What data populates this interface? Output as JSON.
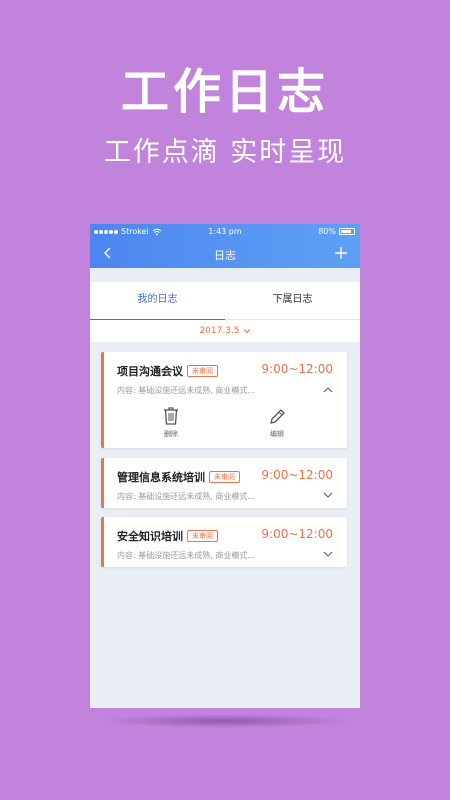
{
  "hero": {
    "title": "工作日志",
    "subtitle": "工作点滴 实时呈现"
  },
  "status_bar": {
    "carrier": "Strokei",
    "time": "1:43 pm",
    "battery": "80%"
  },
  "nav": {
    "title": "日志",
    "back_icon": "chevron-left-icon",
    "add_icon": "plus-icon"
  },
  "tabs": [
    {
      "label": "我的日志",
      "active": true
    },
    {
      "label": "下属日志",
      "active": false
    }
  ],
  "date_filter": {
    "value": "2017.3.5"
  },
  "logs": [
    {
      "title": "项目沟通会议",
      "badge": "未审阅",
      "time": "9:00~12:00",
      "content": "内容: 基础设施还远未成熟, 商业模式...",
      "expanded": true,
      "actions": [
        {
          "label": "删除",
          "icon": "trash-icon"
        },
        {
          "label": "编辑",
          "icon": "pencil-icon"
        }
      ]
    },
    {
      "title": "管理信息系统培训",
      "badge": "未审阅",
      "time": "9:00~12:00",
      "content": "内容: 基础设施还远未成熟, 商业模式...",
      "expanded": false
    },
    {
      "title": "安全知识培训",
      "badge": "未审阅",
      "time": "9:00~12:00",
      "content": "内容: 基础设施还远未成熟, 商业模式...",
      "expanded": false
    }
  ],
  "colors": {
    "background": "#c283dc",
    "header_start": "#4c86f0",
    "header_end": "#5fa0f5",
    "accent": "#f0714a",
    "tab_active": "#3f6fd8"
  }
}
